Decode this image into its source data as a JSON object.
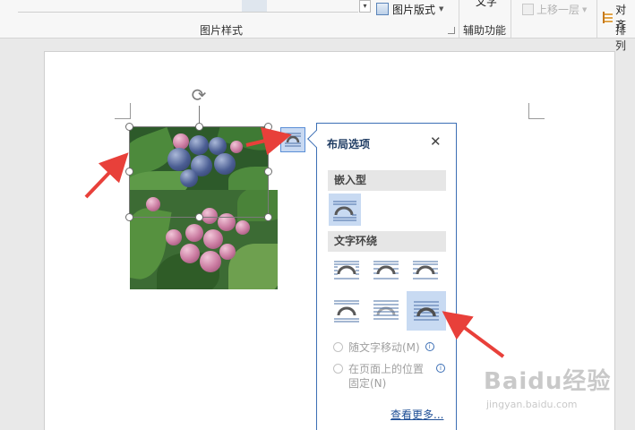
{
  "ribbon": {
    "picture_layout_label": "图片版式",
    "alt_text_line1": "",
    "alt_text_line2": "文字",
    "bring_forward_label": "上移一层",
    "align_label": "对齐",
    "group_picture_styles": "图片样式",
    "group_accessibility": "辅助功能",
    "group_arrange": "排列"
  },
  "flyout": {
    "title": "布局选项",
    "close_glyph": "✕",
    "section_inline": "嵌入型",
    "section_wrap": "文字环绕",
    "selected_option": "behind-text",
    "move_with_text": "随文字移动(M)",
    "fix_position": "在页面上的位置固定(N)",
    "see_more": "查看更多..."
  },
  "icons": {
    "rotate": "rotate-handle-icon",
    "layout_options": "layout-options-icon",
    "close": "close-icon",
    "info": "info-icon"
  },
  "colors": {
    "accent": "#3c6fb5",
    "selected_option": "#c8daf2",
    "arrow": "#e8403a"
  },
  "watermark": {
    "brand": "Baidu经验",
    "url": "jingyan.baidu.com"
  }
}
